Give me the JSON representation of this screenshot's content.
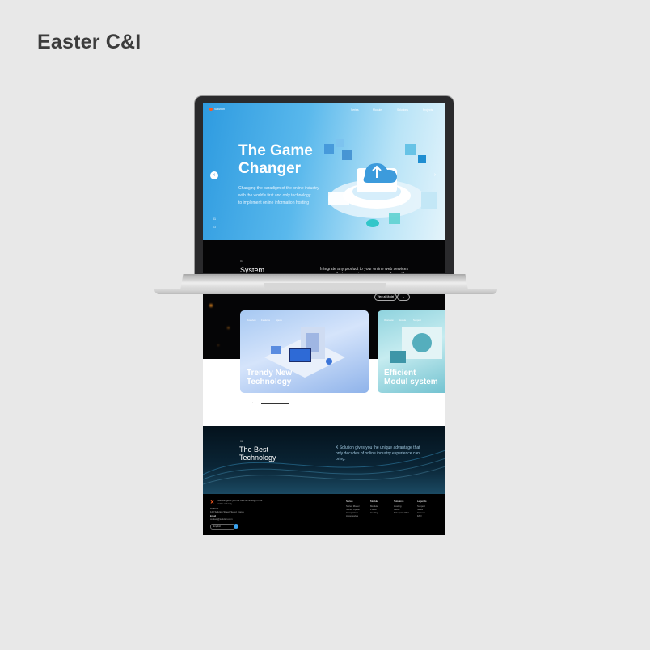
{
  "page": {
    "title": "Easter C&I"
  },
  "site": {
    "nav": {
      "logo": "Solution",
      "items": [
        "Series",
        "Module",
        "Solutions",
        "Projects"
      ]
    },
    "hero": {
      "title": "The Game\nChanger",
      "subtitle": "Changing the paradigm of the online industry\nwith the world's first and only technology\nto implement online information hosting",
      "page_current": "01",
      "page_total": "03",
      "prev_icon": "‹",
      "next_icon": "›"
    },
    "system": {
      "label": "01",
      "title": "System",
      "description": "Integrate any product to your online web services systems that companies were never before with.",
      "view_more": "View all Model",
      "arrow": "→"
    },
    "cards": [
      {
        "title": "Trendy New\nTechnology",
        "nav": [
          "Overview",
          "Features",
          "Specs"
        ]
      },
      {
        "title": "Efficient\nModul system",
        "nav": [
          "Overview",
          "Module",
          "Support"
        ]
      }
    ],
    "carousel": {
      "prev": "←",
      "next": "→",
      "progress": 0.23
    },
    "technology": {
      "label": "02",
      "title": "The Best\nTechnology",
      "description": "X Solution gives you the unique advantage that only decades of online industry experience can bring."
    },
    "footer": {
      "tagline": "Solution gives you the best technology in the online industry.",
      "address_label": "Address",
      "address": "123 Solution Street, Seoul, Korea",
      "email_label": "Email",
      "email": "contact@solution.com",
      "lang": "English",
      "columns": [
        {
          "head": "Series",
          "items": [
            "Series Model",
            "Series Option",
            "Comparison",
            "Accessories"
          ]
        },
        {
          "head": "Module",
          "items": [
            "Module",
            "Power",
            "Cooling"
          ]
        },
        {
          "head": "Solutions",
          "items": [
            "Hosting",
            "Cloud",
            "Enterprise Plan"
          ]
        },
        {
          "head": "Legends",
          "items": [
            "Support",
            "News",
            "Careers",
            "FAQ"
          ]
        }
      ]
    }
  },
  "colors": {
    "hero_start": "#2e9be0",
    "hero_end": "#e4f4fb",
    "accent": "#ff5a1f",
    "footer_dot": "#3aa3f0"
  }
}
